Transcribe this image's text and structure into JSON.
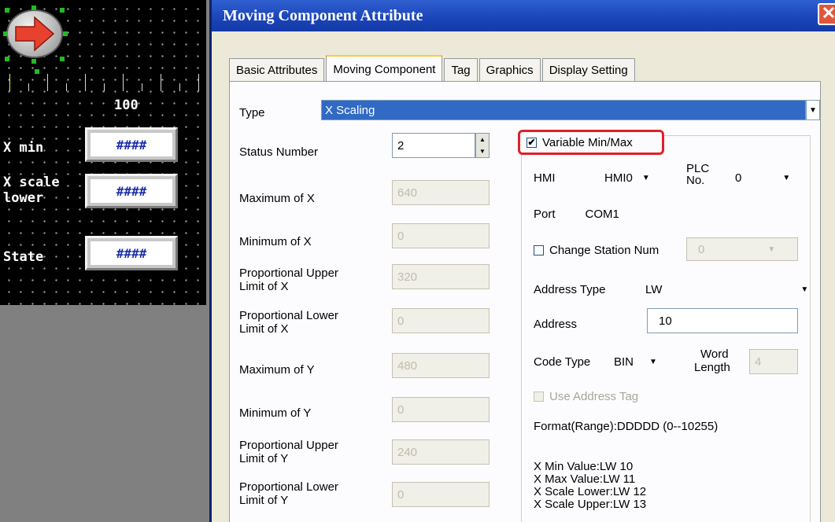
{
  "hmi": {
    "scale_value": "100",
    "x_min_label": "X min",
    "x_scale_lower_label_line1": "X scale",
    "x_scale_lower_label_line2": "lower",
    "state_label": "State",
    "placeholder": "####"
  },
  "dialog": {
    "title": "Moving Component Attribute",
    "close": "✕",
    "tabs": [
      "Basic Attributes",
      "Moving Component",
      "Tag",
      "Graphics",
      "Display Setting"
    ],
    "active_tab": "Moving Component",
    "type_label": "Type",
    "type_value": "X Scaling",
    "status_number_label": "Status Number",
    "status_number_value": "2",
    "max_x_label": "Maximum of X",
    "max_x_value": "640",
    "min_x_label": "Minimum of X",
    "min_x_value": "0",
    "prop_upper_x_label_1": "Proportional Upper",
    "prop_upper_x_label_2": "Limit of X",
    "prop_upper_x_value": "320",
    "prop_lower_x_label_1": "Proportional Lower",
    "prop_lower_x_label_2": "Limit of X",
    "prop_lower_x_value": "0",
    "max_y_label": "Maximum of Y",
    "max_y_value": "480",
    "min_y_label": "Minimum of Y",
    "min_y_value": "0",
    "prop_upper_y_label_1": "Proportional Upper",
    "prop_upper_y_label_2": "Limit of Y",
    "prop_upper_y_value": "240",
    "prop_lower_y_label_1": "Proportional Lower",
    "prop_lower_y_label_2": "Limit of Y",
    "prop_lower_y_value": "0",
    "variable_minmax_label": "Variable Min/Max",
    "variable_minmax_checked": "✔",
    "hmi_label": "HMI",
    "hmi_value": "HMI0",
    "plc_label_1": "PLC",
    "plc_label_2": "No.",
    "plc_value": "0",
    "port_label": "Port",
    "port_value": "COM1",
    "change_station_label": "Change Station Num",
    "change_station_value": "0",
    "address_type_label": "Address Type",
    "address_type_value": "LW",
    "address_label": "Address",
    "address_value": "10",
    "code_type_label": "Code Type",
    "code_type_value": "BIN",
    "word_length_label_1": "Word",
    "word_length_label_2": "Length",
    "word_length_value": "4",
    "use_address_tag_label": "Use Address Tag",
    "format_text": "Format(Range):DDDDD (0--10255)",
    "x_min_value_text": "X Min Value:LW 10",
    "x_max_value_text": "X Max Value:LW 11",
    "x_scale_lower_text": "X Scale Lower:LW 12",
    "x_scale_upper_text": "X Scale Upper:LW 13"
  },
  "colors": {
    "title_bar": "#1a44b8",
    "highlight_box": "#e0202a",
    "selection": "#316ac5"
  },
  "icons": [
    "right-arrow-icon",
    "close-icon",
    "dropdown-arrow-icon",
    "spin-up-icon",
    "spin-down-icon",
    "checkbox-icon"
  ]
}
